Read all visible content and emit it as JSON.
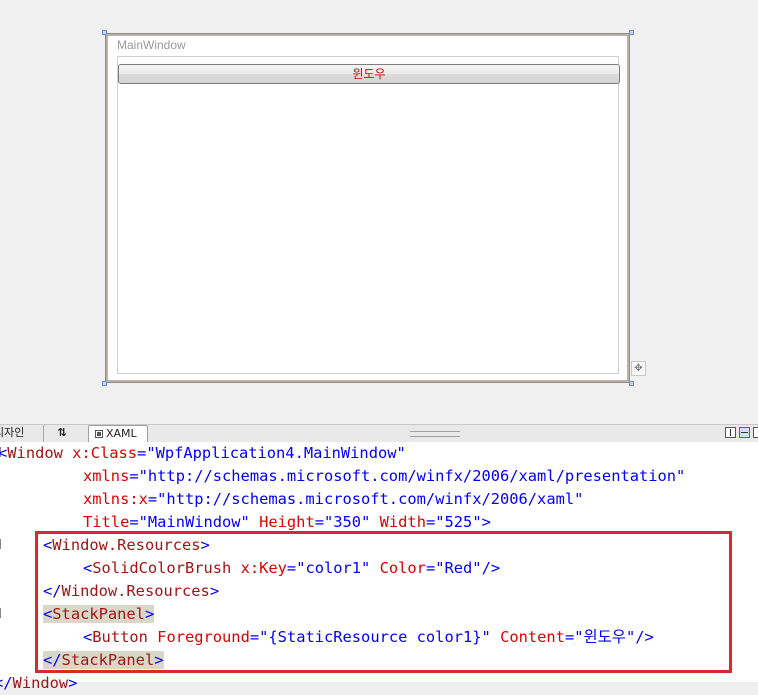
{
  "designer": {
    "window_title": "MainWindow",
    "button_content": "윈도우",
    "button_color": "#e00000"
  },
  "tabs": {
    "design_label": "디자인",
    "swap_label": "⇅",
    "xaml_label": "XAML"
  },
  "code": {
    "line1": {
      "open": "<",
      "tag": "Window",
      "attr": " x:Class",
      "eq": "=",
      "val": "\"WpfApplication4.MainWindow\""
    },
    "line2": {
      "attr": "xmlns",
      "eq": "=",
      "val": "\"http://schemas.microsoft.com/winfx/2006/xaml/presentation\""
    },
    "line3": {
      "attr": "xmlns:x",
      "eq": "=",
      "val": "\"http://schemas.microsoft.com/winfx/2006/xaml\""
    },
    "line4": {
      "attr1": "Title",
      "val1": "\"MainWindow\"",
      "attr2": "Height",
      "val2": "\"350\"",
      "attr3": "Width",
      "val3": "\"525\"",
      "close": ">"
    },
    "line5": {
      "open": "<",
      "tag": "Window.Resources",
      "close": ">"
    },
    "line6": {
      "open": "<",
      "tag": "SolidColorBrush",
      "attr1": "x:Key",
      "val1": "\"color1\"",
      "attr2": "Color",
      "val2": "\"Red\"",
      "close": "/>"
    },
    "line7": {
      "open": "</",
      "tag": "Window.Resources",
      "close": ">"
    },
    "line8": {
      "open": "<",
      "tag": "StackPanel",
      "close": ">"
    },
    "line9": {
      "open": "<",
      "tag": "Button",
      "attr1": "Foreground",
      "val1": "\"{StaticResource color1}\"",
      "attr2": "Content",
      "val2": "\"윈도우\"",
      "close": "/>"
    },
    "line10": {
      "open": "</",
      "tag": "StackPanel",
      "close": ">"
    },
    "line11": {
      "open": "</",
      "tag": "Window",
      "close": ">"
    }
  },
  "colors": {
    "tag": "#a31515",
    "attribute": "#e00000",
    "value": "#0000ff",
    "callout_border": "#d42b2b"
  }
}
